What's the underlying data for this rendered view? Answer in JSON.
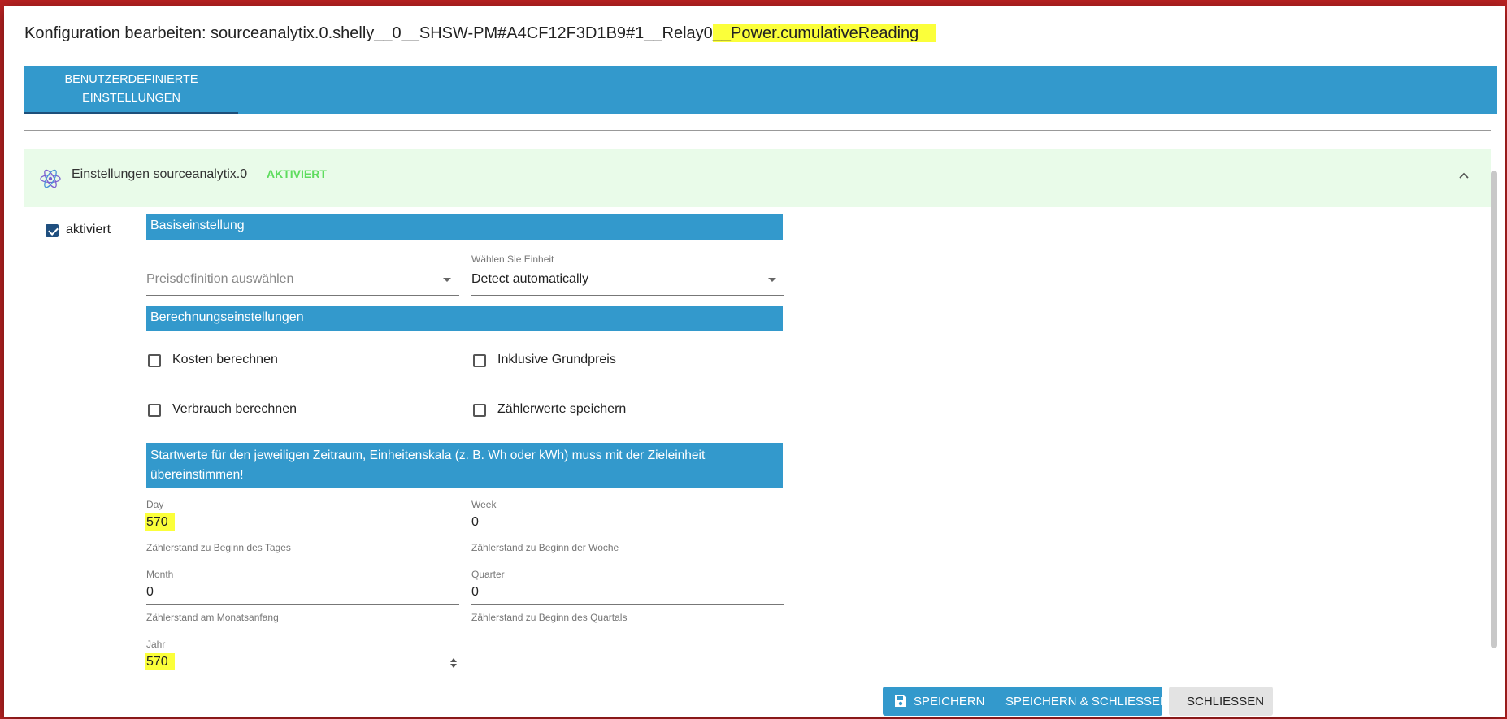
{
  "dialog": {
    "title_prefix": "Konfiguration bearbeiten: sourceanalytix.0.shelly__0__SHSW-PM#A4CF12F3D1B9#1__Relay0",
    "title_highlight": "__Power.cumulativeReading"
  },
  "tabs": [
    {
      "label": "BENUTZERDEFINIERTE EINSTELLUNGEN"
    }
  ],
  "panel": {
    "icon": "sourceanalytix-atom-icon",
    "title": "Einstellungen sourceanalytix.0",
    "status": "AKTIVIERT"
  },
  "enabled": {
    "label": "aktiviert",
    "checked": true
  },
  "sections": {
    "basic": "Basiseinstellung",
    "calc": "Berechnungseinstellungen",
    "start": "Startwerte für den jeweiligen Zeitraum, Einheitenskala (z. B. Wh oder kWh) muss mit der Zieleinheit übereinstimmen!"
  },
  "price_select": {
    "placeholder": "Preisdefinition auswählen"
  },
  "unit_select": {
    "label": "Wählen Sie Einheit",
    "value": "Detect automatically"
  },
  "checkboxes": {
    "costs": {
      "label": "Kosten berechnen",
      "checked": false
    },
    "base_price": {
      "label": "Inklusive Grundpreis",
      "checked": false
    },
    "consumption": {
      "label": "Verbrauch berechnen",
      "checked": false
    },
    "meter_values": {
      "label": "Zählerwerte speichern",
      "checked": false
    }
  },
  "fields": {
    "day": {
      "label": "Day",
      "value": "570",
      "help": "Zählerstand zu Beginn des Tages"
    },
    "week": {
      "label": "Week",
      "value": "0",
      "help": "Zählerstand zu Beginn der Woche"
    },
    "month": {
      "label": "Month",
      "value": "0",
      "help": "Zählerstand am Monatsanfang"
    },
    "quarter": {
      "label": "Quarter",
      "value": "0",
      "help": "Zählerstand zu Beginn des Quartals"
    },
    "year": {
      "label": "Jahr",
      "value": "570"
    }
  },
  "buttons": {
    "save": "SPEICHERN",
    "save_close": "SPEICHERN & SCHLIESSEN",
    "close": "SCHLIESSEN"
  },
  "colors": {
    "accent": "#3399cc",
    "panel_bg": "#e9fbe9",
    "status_green": "#5fdc5f",
    "highlight": "#fbff3a"
  }
}
